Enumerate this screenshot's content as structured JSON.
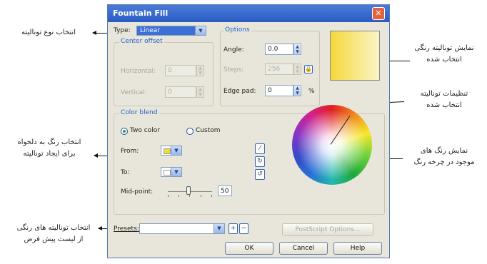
{
  "dialog": {
    "title": "Fountain Fill",
    "close_glyph": "✕",
    "type_label": "Type:",
    "type_value": "Linear",
    "center_offset": {
      "title": "Center offset",
      "horizontal_label": "Horizontal:",
      "horizontal_value": "0",
      "vertical_label": "Vertical:",
      "vertical_value": "0"
    },
    "options": {
      "title": "Options",
      "angle_label": "Angle:",
      "angle_value": "0.0",
      "steps_label": "Steps:",
      "steps_value": "256",
      "edge_pad_label": "Edge pad:",
      "edge_pad_value": "0",
      "percent_symbol": "%"
    },
    "color_blend": {
      "title": "Color blend",
      "two_color_label": "Two color",
      "custom_label": "Custom",
      "selected": "two_color",
      "from_label": "From:",
      "from_color": "#f4d93a",
      "to_label": "To:",
      "to_color": "#ffffff",
      "mid_point_label": "Mid-point:",
      "mid_point_value": "50"
    },
    "presets_label": "Presets:",
    "presets_value": "",
    "postscript_button": "PostScript Options...",
    "ok_button": "OK",
    "cancel_button": "Cancel",
    "help_button": "Help",
    "preview_colors": [
      "#f4d93a",
      "#fbf4c8"
    ]
  },
  "annotations": {
    "type_select": "انتخاب نوع تونالیته",
    "preview_line1": "نمایش تونالیته رنگی",
    "preview_line2": "انتخاب شده",
    "settings_line1": "تنظیمات تونالیته",
    "settings_line2": "انتخاب شده",
    "color_choice_line1": "انتخاب رنگ به دلخواه",
    "color_choice_line2": "برای ایجاد تونالیته",
    "wheel_line1": "نمایش رنگ های",
    "wheel_line2": "موجود در چرخه رنگ",
    "presets_line1": "انتخاب تونالیته های رنگی",
    "presets_line2": "از لیست پیش فرض"
  }
}
